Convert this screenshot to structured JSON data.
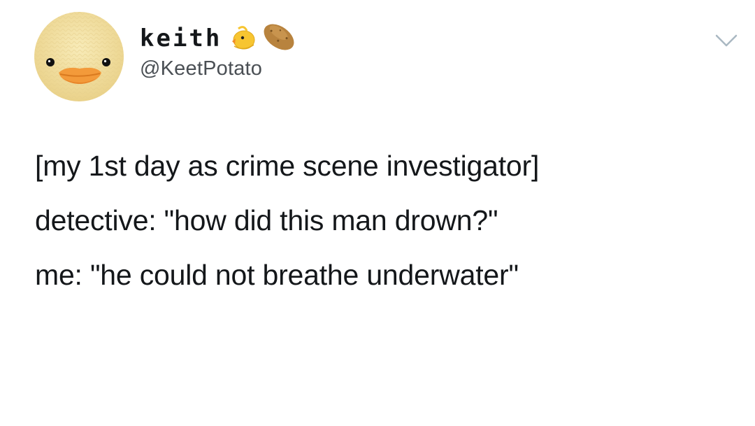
{
  "tweet": {
    "author": {
      "display_name": "keith",
      "handle": "@KeetPotato",
      "name_emojis": [
        "baby-chick-icon",
        "potato-icon"
      ],
      "avatar": "duck-face-avatar"
    },
    "menu_icon": "chevron-down-icon",
    "lines": [
      "[my 1st day as crime scene investigator]",
      "detective: \"how did this man drown?\"",
      "me: \"he could not breathe underwater\""
    ]
  },
  "colors": {
    "text": "#14171a",
    "handle": "#4a4f54",
    "avatar_bg": "#f4e2a6",
    "beak": "#f39a3a",
    "caret": "#aab8c2"
  }
}
